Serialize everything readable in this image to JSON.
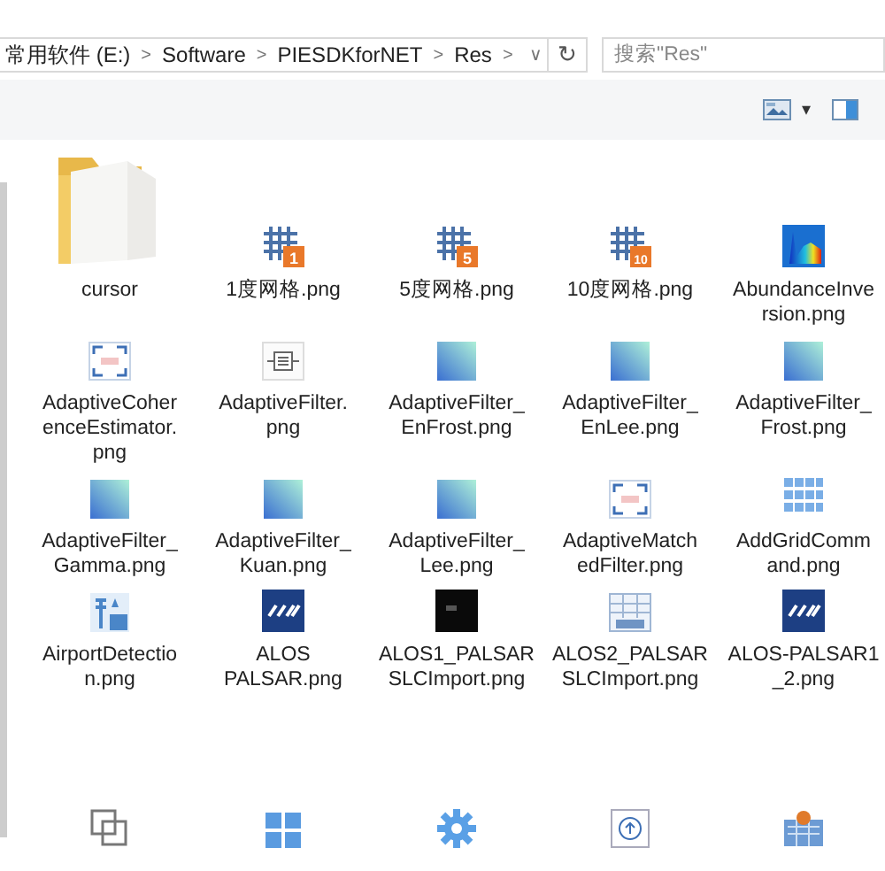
{
  "address_bar": {
    "crumbs": [
      "常用软件 (E:)",
      "Software",
      "PIESDKforNET",
      "Res"
    ],
    "separator": ">",
    "dropdown": "∨",
    "refresh": "↻"
  },
  "search": {
    "placeholder": "搜索\"Res\""
  },
  "toolbar": {
    "caret": "▾"
  },
  "rows": [
    {
      "items": [
        {
          "kind": "folder",
          "lines": [
            "cursor"
          ]
        },
        {
          "kind": "grid",
          "badge": "1",
          "lines": [
            "1度网格.png"
          ]
        },
        {
          "kind": "grid",
          "badge": "5",
          "lines": [
            "5度网格.png"
          ]
        },
        {
          "kind": "grid",
          "badge": "10",
          "lines": [
            "10度网格.png"
          ]
        },
        {
          "kind": "heatmap",
          "lines": [
            "AbundanceInve",
            "rsion.png"
          ]
        }
      ]
    },
    {
      "items": [
        {
          "kind": "frame",
          "lines": [
            "AdaptiveCoher",
            "enceEstimator.",
            "png"
          ]
        },
        {
          "kind": "filter",
          "lines": [
            "AdaptiveFilter.",
            "png"
          ]
        },
        {
          "kind": "gradient",
          "lines": [
            "AdaptiveFilter_",
            "EnFrost.png"
          ]
        },
        {
          "kind": "gradient",
          "lines": [
            "AdaptiveFilter_",
            "EnLee.png"
          ]
        },
        {
          "kind": "gradient",
          "lines": [
            "AdaptiveFilter_",
            "Frost.png"
          ]
        }
      ]
    },
    {
      "items": [
        {
          "kind": "gradient",
          "lines": [
            "AdaptiveFilter_",
            "Gamma.png"
          ]
        },
        {
          "kind": "gradient",
          "lines": [
            "AdaptiveFilter_",
            "Kuan.png"
          ]
        },
        {
          "kind": "gradient",
          "lines": [
            "AdaptiveFilter_",
            "Lee.png"
          ]
        },
        {
          "kind": "frame",
          "lines": [
            "AdaptiveMatch",
            "edFilter.png"
          ]
        },
        {
          "kind": "tiles",
          "lines": [
            "AddGridComm",
            "and.png"
          ]
        }
      ]
    },
    {
      "items": [
        {
          "kind": "airport",
          "lines": [
            "AirportDetectio",
            "n.png"
          ]
        },
        {
          "kind": "logo",
          "lines": [
            "ALOS",
            "PALSAR.png"
          ]
        },
        {
          "kind": "dark",
          "lines": [
            "ALOS1_PALSAR",
            "SLCImport.png"
          ]
        },
        {
          "kind": "table",
          "lines": [
            "ALOS2_PALSAR",
            "SLCImport.png"
          ]
        },
        {
          "kind": "logo",
          "lines": [
            "ALOS-PALSAR1",
            "_2.png"
          ]
        }
      ]
    },
    {
      "items": [
        {
          "kind": "overlap"
        },
        {
          "kind": "window"
        },
        {
          "kind": "gear"
        },
        {
          "kind": "upload"
        },
        {
          "kind": "map"
        }
      ]
    }
  ]
}
